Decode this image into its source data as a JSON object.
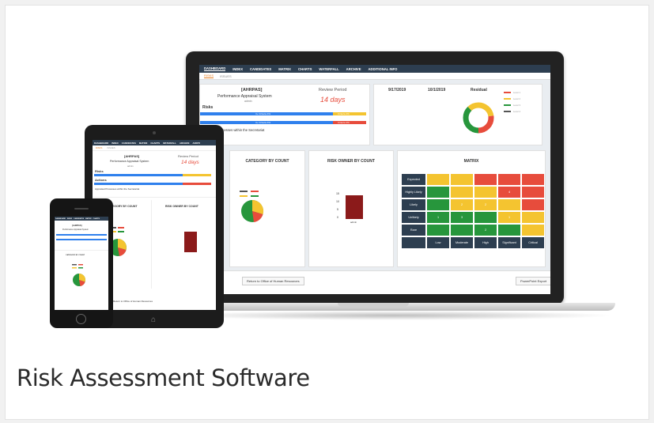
{
  "caption": "Risk Assessment Software",
  "laptop": {
    "nav_tabs": [
      "DASHBOARD",
      "INDEX",
      "CANDIDATES",
      "MATRIX",
      "CHARTS",
      "WATERFALL",
      "ARCHIVE",
      "ADDITIONAL INFO"
    ],
    "sub_tabs": [
      "RISKS",
      "ISSUES"
    ],
    "system_code": "[AHRPAS]",
    "system_name": "Performance Appraisal System",
    "system_owner": "admin",
    "review_period_label": "Review Period",
    "review_period_value": "14 days",
    "risks_label": "Risks",
    "risk_bar_1": "3+ Criteria 4%",
    "risk_bar_1b": "Criteria 4%",
    "risk_bar_2": "3+ Criteria 4%",
    "risk_bar_2b": "Criteria 4%",
    "process_text": "Appraisal Processes within the Secretariat",
    "date_1": "9/17/2019",
    "date_2": "10/1/2019",
    "residual_label": "Residual",
    "residual_legend": [
      "Level 1",
      "Level 2",
      "Level 3",
      "Level 4"
    ],
    "category_title": "CATEGORY BY COUNT",
    "owner_title": "RISK OWNER BY COUNT",
    "owner_y_ticks": [
      "15",
      "10",
      "5",
      "0"
    ],
    "owner_bar_label": "admin",
    "matrix_title": "MATRIX",
    "matrix_rows": [
      "Expected",
      "Highly Likely",
      "Likely",
      "Unlikely",
      "Rare"
    ],
    "matrix_cols": [
      "Low",
      "Moderate",
      "High",
      "Significant",
      "Critical"
    ],
    "matrix_values": [
      [
        "",
        "",
        "",
        "",
        ""
      ],
      [
        "",
        "",
        "",
        "4",
        ""
      ],
      [
        "",
        "2",
        "2",
        "",
        ""
      ],
      [
        "1",
        "3",
        "",
        "1",
        ""
      ],
      [
        "",
        "",
        "2",
        "",
        ""
      ]
    ],
    "return_button": "Return to Office of Human Resources",
    "export_button": "PowerPoint Export"
  },
  "tablet": {
    "nav_tabs": [
      "DASHBOARD",
      "INDEX",
      "CANDIDATES",
      "MATRIX",
      "CHARTS",
      "WATERFALL",
      "ARCHIVE",
      "ADDITI"
    ],
    "sub_tabs": [
      "RISKS",
      "ISSUES"
    ],
    "system_code": "[AHRPAS]",
    "system_name": "Performance Appraisal System",
    "system_owner": "admin",
    "review_period_label": "Review Period",
    "review_period_value": "14 days",
    "risks_label": "Risks",
    "actions_label": "Actions",
    "process_text": "Appraisal Processes within the Secretariat",
    "category_title": "CATEGORY BY COUNT",
    "owner_title": "RISK OWNER BY COUNT",
    "return_button": "Return to Office of Human Resources"
  },
  "phone": {
    "nav_tabs": [
      "DASHBOARD",
      "INDEX",
      "CANDIDATES",
      "MATRIX",
      "CHARTS"
    ],
    "system_code": "[AHRPAS]",
    "system_name": "Performance Appraisal System",
    "category_title": "CATEGORY BY COUNT"
  },
  "colors": {
    "nav": "#2d3e50",
    "blue": "#2f80ed",
    "yellow": "#f4c430",
    "red": "#e74c3c",
    "green": "#27963c",
    "dark_red": "#8b1a1a",
    "accent": "#e67e22"
  }
}
